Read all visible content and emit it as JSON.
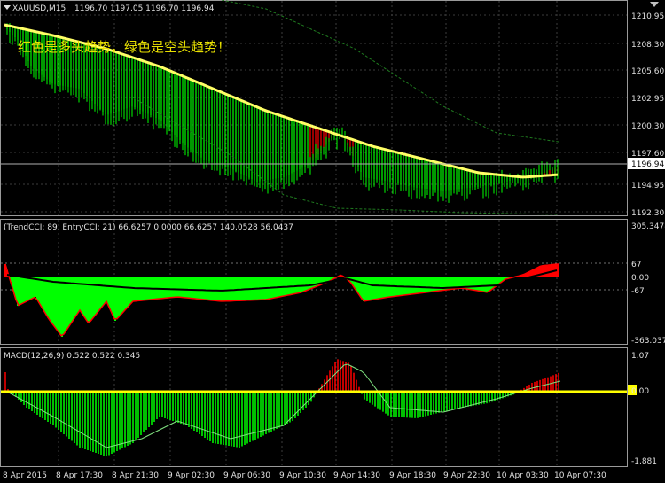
{
  "header": {
    "title": "XAUUSD,M15",
    "quote": "1196.70 1197.05 1196.70 1196.94"
  },
  "note": "红色是多头趋势，绿色是空头趋势！",
  "price_axis": {
    "ticks": [
      "1210.95",
      "1208.30",
      "1205.60",
      "1202.95",
      "1200.30",
      "1197.60",
      "1194.95",
      "1192.30"
    ],
    "current_price": "1196.94"
  },
  "cci_pane": {
    "legend": "(TrendCCI: 89, EntryCCI: 21)  66.6257 0.0000 66.6257 140.0528 56.0437",
    "axis_ticks": [
      "305.3478",
      "67",
      "0.00",
      "-67",
      "-363.037"
    ]
  },
  "macd_pane": {
    "legend": "MACD(12,26,9) 0.522 0.522 0.345",
    "axis_ticks": [
      "1.07",
      "0.00",
      "-1.881"
    ]
  },
  "time_axis": {
    "labels": [
      "8 Apr 2015",
      "8 Apr 17:30",
      "8 Apr 21:30",
      "9 Apr 02:30",
      "9 Apr 06:30",
      "9 Apr 10:30",
      "9 Apr 14:30",
      "9 Apr 18:30",
      "9 Apr 22:30",
      "10 Apr 03:30",
      "10 Apr 07:30"
    ]
  },
  "colors": {
    "background": "#000000",
    "grid": "#3c3c3c",
    "bull": "#ff0000",
    "bear": "#00ff00",
    "ma": "#ffff66",
    "macd_line": "#ffff00",
    "text": "#e0e0e0"
  }
}
